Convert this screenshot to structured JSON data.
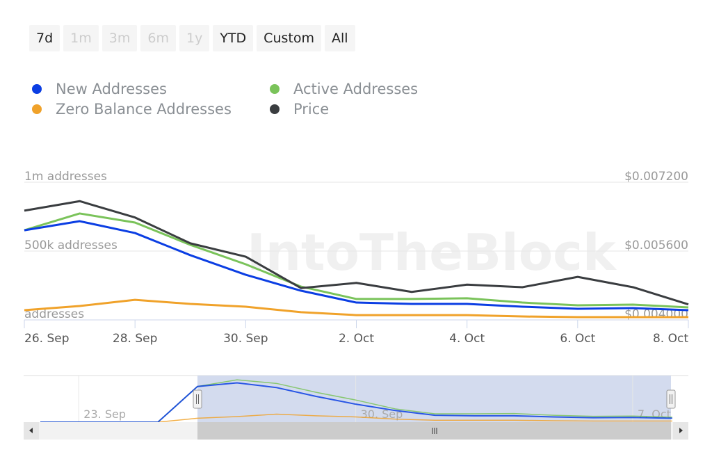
{
  "range_selector": {
    "buttons": [
      {
        "label": "7d",
        "enabled": true
      },
      {
        "label": "1m",
        "enabled": false
      },
      {
        "label": "3m",
        "enabled": false
      },
      {
        "label": "6m",
        "enabled": false
      },
      {
        "label": "1y",
        "enabled": false
      },
      {
        "label": "YTD",
        "enabled": true
      },
      {
        "label": "Custom",
        "enabled": true
      },
      {
        "label": "All",
        "enabled": true
      }
    ]
  },
  "watermark": "IntoTheBlock",
  "chart_data": {
    "type": "line",
    "x": [
      "26 Sep",
      "27 Sep",
      "28 Sep",
      "29 Sep",
      "30 Sep",
      "1 Oct",
      "2 Oct",
      "3 Oct",
      "4 Oct",
      "5 Oct",
      "6 Oct",
      "7 Oct",
      "8 Oct"
    ],
    "x_tick_labels": [
      "26. Sep",
      "28. Sep",
      "30. Sep",
      "2. Oct",
      "4. Oct",
      "6. Oct",
      "8. Oct"
    ],
    "left_axis": {
      "ticks": [
        "addresses",
        "500k addresses",
        "1m addresses"
      ],
      "tick_values": [
        0,
        500000,
        1000000
      ],
      "ylim": [
        0,
        1000000
      ]
    },
    "right_axis": {
      "ticks": [
        "$0.004000",
        "$0.005600",
        "$0.007200"
      ],
      "tick_values": [
        0.004,
        0.0056,
        0.0072
      ],
      "ylim": [
        0.004,
        0.0072
      ]
    },
    "grid": true,
    "legend_position": "top-left",
    "series": [
      {
        "name": "New Addresses",
        "color": "#0b3ee3",
        "axis": "left",
        "values": [
          651000,
          717000,
          631000,
          470000,
          328000,
          212000,
          126000,
          116000,
          116000,
          96000,
          81000,
          86000,
          71000
        ]
      },
      {
        "name": "Active Addresses",
        "color": "#7ac35a",
        "axis": "left",
        "values": [
          651000,
          773000,
          707000,
          545000,
          404000,
          242000,
          152000,
          152000,
          157000,
          126000,
          106000,
          111000,
          91000
        ]
      },
      {
        "name": "Zero Balance Addresses",
        "color": "#f0a22a",
        "axis": "left",
        "values": [
          71000,
          101000,
          146000,
          116000,
          96000,
          56000,
          35000,
          35000,
          35000,
          25000,
          20000,
          20000,
          20000
        ]
      },
      {
        "name": "Price",
        "color": "#3a3d40",
        "axis": "right",
        "values": [
          0.00654,
          0.00676,
          0.00638,
          0.00578,
          0.00547,
          0.00474,
          0.00486,
          0.00465,
          0.00482,
          0.00476,
          0.005,
          0.00476,
          0.00436
        ]
      }
    ],
    "navigator": {
      "tick_labels": [
        "23. Sep",
        "30. Sep",
        "7. Oct"
      ],
      "selected_range": [
        "26 Sep",
        "8 Oct"
      ]
    }
  }
}
